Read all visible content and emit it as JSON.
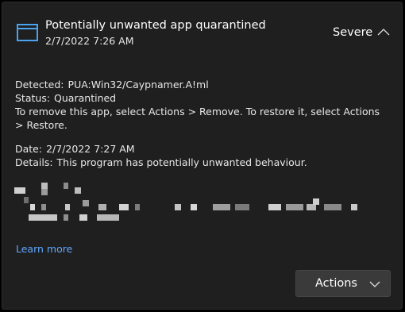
{
  "header": {
    "title": "Potentially unwanted app quarantined",
    "timestamp": "2/7/2022 7:26 AM",
    "severity": "Severe",
    "icon": "app-window-icon"
  },
  "details": {
    "detected_label": "Detected:",
    "detected_value": "PUA:Win32/Caypnamer.A!ml",
    "status_label": "Status:",
    "status_value": "Quarantined",
    "instructions": "To remove this app, select Actions > Remove. To restore it, select Actions > Restore.",
    "date_label": "Date:",
    "date_value": "2/7/2022 7:27 AM",
    "details_label": "Details:",
    "details_value": "This program has potentially unwanted behaviour."
  },
  "learn_more": "Learn more",
  "actions_button": {
    "label": "Actions"
  },
  "colors": {
    "background": "#1f1f1f",
    "accent_icon": "#4aa3f0",
    "link": "#60a8ff",
    "button": "#3a3a3a"
  }
}
